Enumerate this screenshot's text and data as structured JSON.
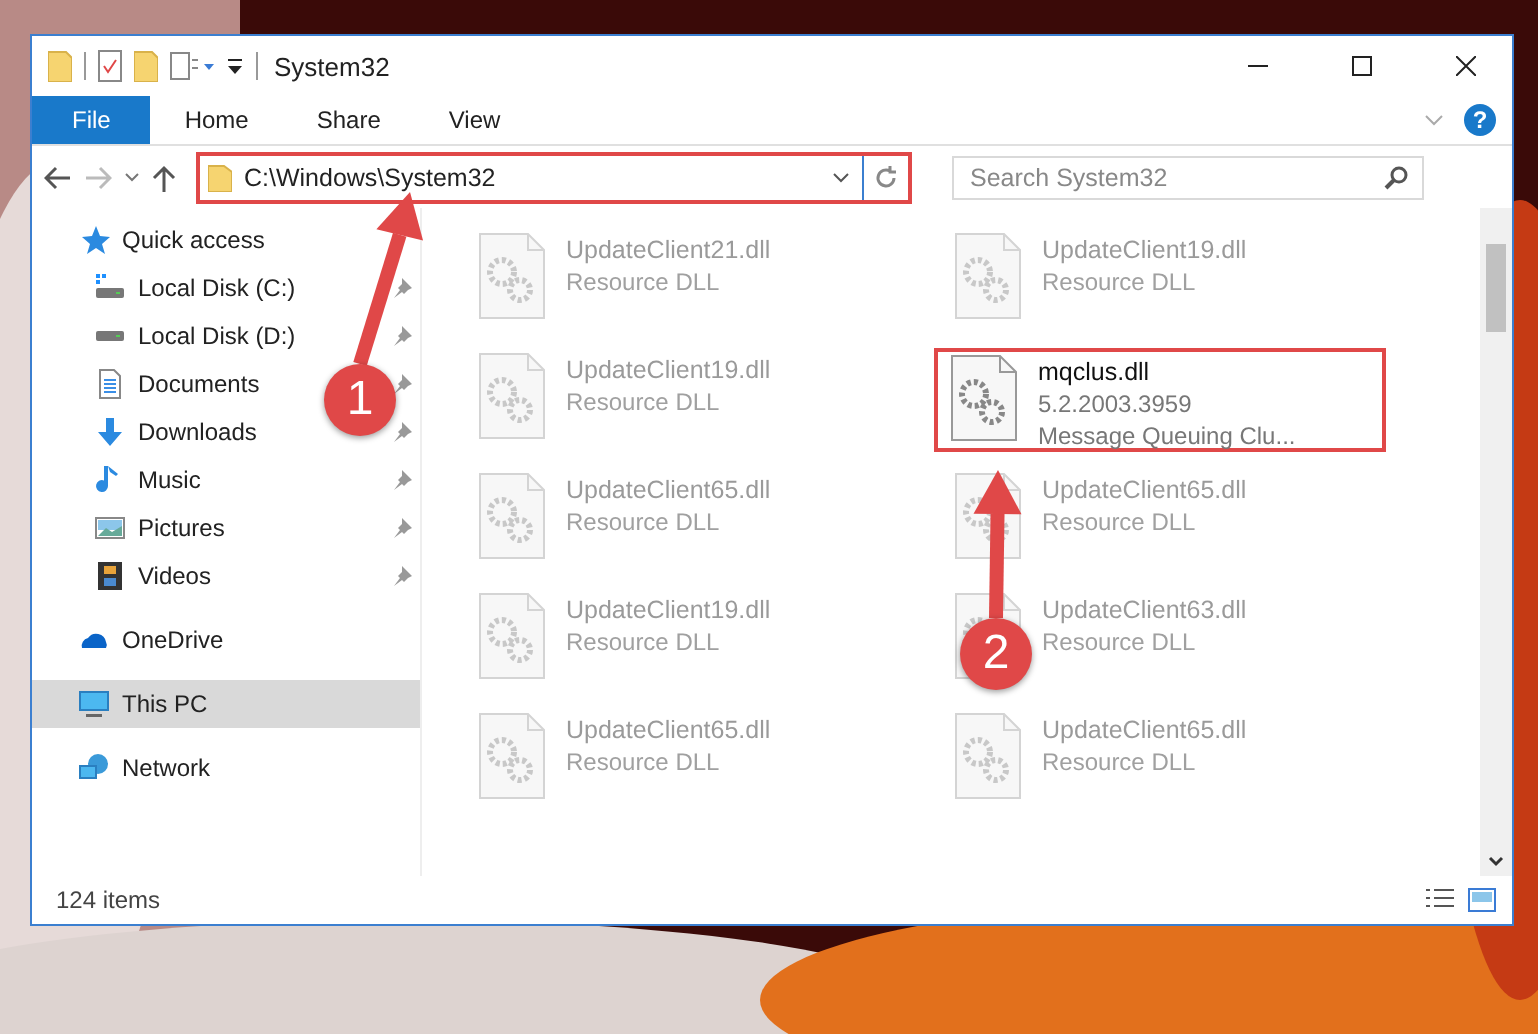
{
  "window": {
    "title": "System32"
  },
  "ribbon": {
    "tabs": [
      {
        "label": "File",
        "kind": "file",
        "selected": false
      },
      {
        "label": "Home",
        "kind": "tab",
        "selected": false
      },
      {
        "label": "Share",
        "kind": "tab",
        "selected": false
      },
      {
        "label": "View",
        "kind": "tab",
        "selected": false
      }
    ],
    "help": "?"
  },
  "address_bar": {
    "path": "C:\\Windows\\System32",
    "highlighted": true
  },
  "search": {
    "placeholder": "Search System32"
  },
  "sidebar": {
    "items": [
      {
        "label": "Quick access",
        "kind": "star",
        "selected": false,
        "children": [
          {
            "label": "Local Disk (C:)",
            "kind": "drive_c",
            "pinned": true,
            "selected": false
          },
          {
            "label": "Local Disk (D:)",
            "kind": "drive",
            "pinned": true,
            "selected": false
          },
          {
            "label": "Documents",
            "kind": "documents",
            "pinned": true,
            "selected": false
          },
          {
            "label": "Downloads",
            "kind": "downloads",
            "pinned": true,
            "selected": false
          },
          {
            "label": "Music",
            "kind": "music",
            "pinned": true,
            "selected": false
          },
          {
            "label": "Pictures",
            "kind": "pictures",
            "pinned": true,
            "selected": false
          },
          {
            "label": "Videos",
            "kind": "videos",
            "pinned": true,
            "selected": false
          }
        ]
      },
      {
        "label": "OneDrive",
        "kind": "cloud",
        "selected": false
      },
      {
        "label": "This PC",
        "kind": "pc",
        "selected": true
      },
      {
        "label": "Network",
        "kind": "network",
        "selected": false
      }
    ]
  },
  "files": [
    {
      "name": "UpdateClient21.dll",
      "detail": [
        "Resource DLL"
      ],
      "highlighted": false
    },
    {
      "name": "UpdateClient19.dll",
      "detail": [
        "Resource DLL"
      ],
      "highlighted": false
    },
    {
      "name": "UpdateClient19.dll",
      "detail": [
        "Resource DLL"
      ],
      "highlighted": false
    },
    {
      "name": "mqclus.dll",
      "detail": [
        "5.2.2003.3959",
        "Message Queuing Clu..."
      ],
      "highlighted": true
    },
    {
      "name": "UpdateClient65.dll",
      "detail": [
        "Resource DLL"
      ],
      "highlighted": false
    },
    {
      "name": "UpdateClient65.dll",
      "detail": [
        "Resource DLL"
      ],
      "highlighted": false
    },
    {
      "name": "UpdateClient19.dll",
      "detail": [
        "Resource DLL"
      ],
      "highlighted": false
    },
    {
      "name": "UpdateClient63.dll",
      "detail": [
        "Resource DLL"
      ],
      "highlighted": false
    },
    {
      "name": "UpdateClient65.dll",
      "detail": [
        "Resource DLL"
      ],
      "highlighted": false
    },
    {
      "name": "UpdateClient65.dll",
      "detail": [
        "Resource DLL"
      ],
      "highlighted": false
    }
  ],
  "status_bar": {
    "count": "124 items"
  },
  "callouts": [
    {
      "number": "1"
    },
    {
      "number": "2"
    }
  ]
}
